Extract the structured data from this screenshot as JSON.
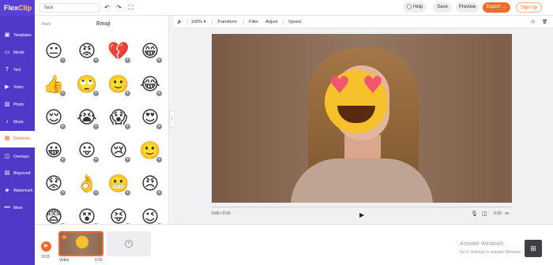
{
  "app": {
    "logo_prefix": "Flex",
    "logo_suffix": "Clip"
  },
  "header": {
    "project_name": "face",
    "help_label": "Help",
    "save_label": "Save",
    "preview_label": "Preview",
    "export_label": "Export →",
    "signup_label": "Sign Up"
  },
  "sidebar": {
    "items": [
      {
        "label": "Templates",
        "icon": "template-icon"
      },
      {
        "label": "Media",
        "icon": "media-icon"
      },
      {
        "label": "Text",
        "icon": "text-icon"
      },
      {
        "label": "Video",
        "icon": "video-icon"
      },
      {
        "label": "Photo",
        "icon": "photo-icon"
      },
      {
        "label": "Music",
        "icon": "music-icon"
      },
      {
        "label": "Elements",
        "icon": "elements-icon",
        "active": true
      },
      {
        "label": "Overlays",
        "icon": "overlays-icon"
      },
      {
        "label": "Bkground",
        "icon": "background-icon"
      },
      {
        "label": "Watermark",
        "icon": "watermark-icon"
      },
      {
        "label": "More",
        "icon": "more-icon"
      }
    ]
  },
  "panel": {
    "back_label": "Back",
    "title": "Emoji",
    "emojis": [
      "😐",
      "😡",
      "💔",
      "😁",
      "👍",
      "🙄",
      "🙂",
      "😂",
      "😌",
      "😭",
      "😱",
      "😍",
      "😀",
      "😛",
      "😢",
      "🙂",
      "😟",
      "👌",
      "😬",
      "😠",
      "😨",
      "😵",
      "😝",
      "😉"
    ]
  },
  "edit_toolbar": {
    "zoom": "100%",
    "transform": "Transform",
    "filter": "Filter",
    "adjust": "Adjust",
    "speed": "Speed"
  },
  "player": {
    "time": "0:00 / 0:15",
    "duration": "0:15"
  },
  "timeline": {
    "total_time": "0:15",
    "clip_number": "01",
    "clip_label": "Video",
    "clip_duration": "0:15"
  },
  "watermark": {
    "title": "Activate Windows",
    "subtitle": "Go to Settings to activate Windows."
  },
  "colors": {
    "brand": "#4e39c8",
    "accent": "#f36b2a"
  }
}
